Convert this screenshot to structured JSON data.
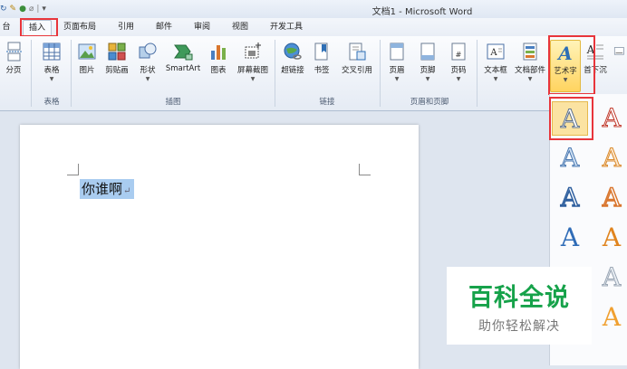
{
  "titlebar": {
    "title": "文档1 - Microsoft Word"
  },
  "tabs": [
    {
      "label": "台"
    },
    {
      "label": "插入"
    },
    {
      "label": "页面布局"
    },
    {
      "label": "引用"
    },
    {
      "label": "邮件"
    },
    {
      "label": "审阅"
    },
    {
      "label": "视图"
    },
    {
      "label": "开发工具"
    }
  ],
  "ribbon": {
    "buttons": [
      {
        "label": "分页"
      },
      {
        "label": "表格"
      },
      {
        "label": "图片"
      },
      {
        "label": "剪贴画"
      },
      {
        "label": "形状"
      },
      {
        "label": "SmartArt"
      },
      {
        "label": "图表"
      },
      {
        "label": "屏幕截图"
      },
      {
        "label": "超链接"
      },
      {
        "label": "书签"
      },
      {
        "label": "交叉引用"
      },
      {
        "label": "页眉"
      },
      {
        "label": "页脚"
      },
      {
        "label": "页码"
      },
      {
        "label": "文本框"
      },
      {
        "label": "文档部件"
      },
      {
        "label": "艺术字"
      },
      {
        "label": "首"
      },
      {
        "label": "下沉"
      }
    ],
    "groups": [
      {
        "label": "表格"
      },
      {
        "label": "插图"
      },
      {
        "label": "链接"
      },
      {
        "label": "页眉和页脚"
      }
    ]
  },
  "document": {
    "text": "你谁啊"
  },
  "gallery": {
    "glyph": "A"
  },
  "watermark": {
    "title": "百科全说",
    "subtitle": "助你轻松解决"
  },
  "colors": {
    "highlight_red": "#e8353b",
    "accent_blue": "#2e6fb5",
    "watermark_green": "#16a24a"
  }
}
